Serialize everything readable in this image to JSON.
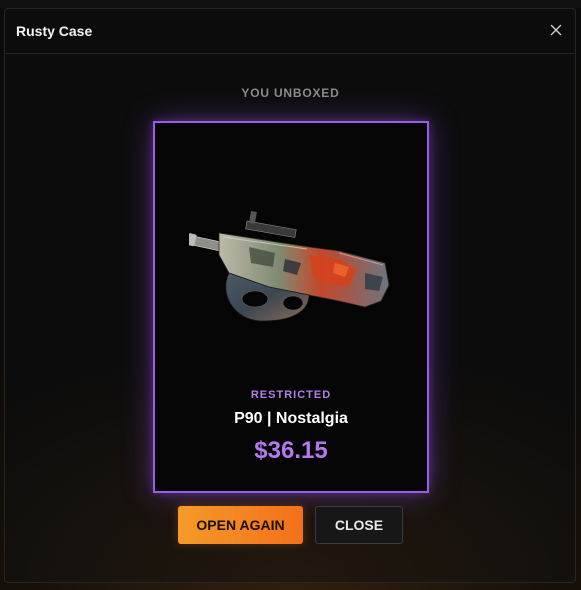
{
  "modal": {
    "title": "Rusty Case",
    "close_icon": "close-icon"
  },
  "result": {
    "eyebrow": "YOU UNBOXED",
    "rarity": "RESTRICTED",
    "item_name": "P90 | Nostalgia",
    "price": "$36.15",
    "image_icon": "p90-weapon-skin-image"
  },
  "actions": {
    "open_again_label": "OPEN AGAIN",
    "close_label": "CLOSE"
  },
  "colors": {
    "rarity_accent": "#9a5be8",
    "open_button": "#f3801f",
    "background": "#0b0b0b"
  }
}
